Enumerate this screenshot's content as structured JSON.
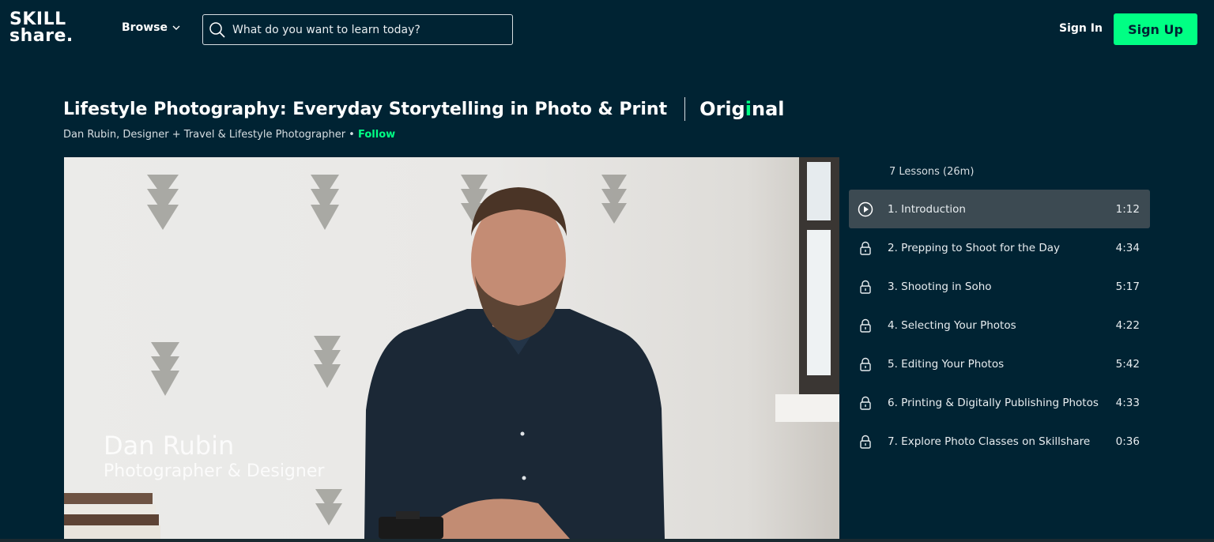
{
  "header": {
    "logo_line1": "SKILL",
    "logo_line2": "share.",
    "browse_label": "Browse",
    "search_placeholder": "What do you want to learn today?",
    "signin_label": "Sign In",
    "signup_label": "Sign Up"
  },
  "course": {
    "title": "Lifestyle Photography: Everyday Storytelling in Photo & Print",
    "badge_pre": "Orig",
    "badge_dot": "i",
    "badge_post": "nal",
    "teacher": "Dan Rubin, Designer + Travel & Lifestyle Photographer •",
    "follow_label": "Follow"
  },
  "video": {
    "caption_name": "Dan Rubin",
    "caption_role": "Photographer & Designer"
  },
  "lessons": {
    "header": "7 Lessons (26m)",
    "items": [
      {
        "title": "1. Introduction",
        "duration": "1:12",
        "icon": "play-icon"
      },
      {
        "title": "2. Prepping to Shoot for the Day",
        "duration": "4:34",
        "icon": "lock-icon"
      },
      {
        "title": "3. Shooting in Soho",
        "duration": "5:17",
        "icon": "lock-icon"
      },
      {
        "title": "4. Selecting Your Photos",
        "duration": "4:22",
        "icon": "lock-icon"
      },
      {
        "title": "5. Editing Your Photos",
        "duration": "5:42",
        "icon": "lock-icon"
      },
      {
        "title": "6. Printing & Digitally Publishing Photos",
        "duration": "4:33",
        "icon": "lock-icon"
      },
      {
        "title": "7. Explore Photo Classes on Skillshare",
        "duration": "0:36",
        "icon": "lock-icon"
      }
    ]
  },
  "colors": {
    "background": "#002333",
    "accent": "#00ff84",
    "active_lesson": "#3c4a52"
  }
}
